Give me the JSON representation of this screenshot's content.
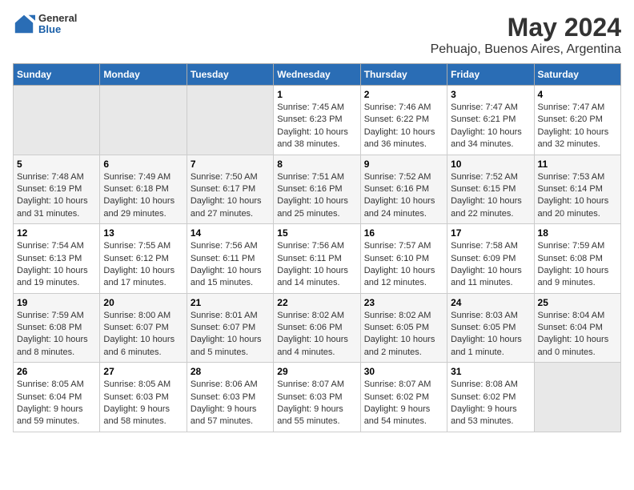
{
  "logo": {
    "general": "General",
    "blue": "Blue"
  },
  "title": "May 2024",
  "subtitle": "Pehuajo, Buenos Aires, Argentina",
  "days_of_week": [
    "Sunday",
    "Monday",
    "Tuesday",
    "Wednesday",
    "Thursday",
    "Friday",
    "Saturday"
  ],
  "weeks": [
    [
      {
        "day": "",
        "info": ""
      },
      {
        "day": "",
        "info": ""
      },
      {
        "day": "",
        "info": ""
      },
      {
        "day": "1",
        "info": "Sunrise: 7:45 AM\nSunset: 6:23 PM\nDaylight: 10 hours\nand 38 minutes."
      },
      {
        "day": "2",
        "info": "Sunrise: 7:46 AM\nSunset: 6:22 PM\nDaylight: 10 hours\nand 36 minutes."
      },
      {
        "day": "3",
        "info": "Sunrise: 7:47 AM\nSunset: 6:21 PM\nDaylight: 10 hours\nand 34 minutes."
      },
      {
        "day": "4",
        "info": "Sunrise: 7:47 AM\nSunset: 6:20 PM\nDaylight: 10 hours\nand 32 minutes."
      }
    ],
    [
      {
        "day": "5",
        "info": "Sunrise: 7:48 AM\nSunset: 6:19 PM\nDaylight: 10 hours\nand 31 minutes."
      },
      {
        "day": "6",
        "info": "Sunrise: 7:49 AM\nSunset: 6:18 PM\nDaylight: 10 hours\nand 29 minutes."
      },
      {
        "day": "7",
        "info": "Sunrise: 7:50 AM\nSunset: 6:17 PM\nDaylight: 10 hours\nand 27 minutes."
      },
      {
        "day": "8",
        "info": "Sunrise: 7:51 AM\nSunset: 6:16 PM\nDaylight: 10 hours\nand 25 minutes."
      },
      {
        "day": "9",
        "info": "Sunrise: 7:52 AM\nSunset: 6:16 PM\nDaylight: 10 hours\nand 24 minutes."
      },
      {
        "day": "10",
        "info": "Sunrise: 7:52 AM\nSunset: 6:15 PM\nDaylight: 10 hours\nand 22 minutes."
      },
      {
        "day": "11",
        "info": "Sunrise: 7:53 AM\nSunset: 6:14 PM\nDaylight: 10 hours\nand 20 minutes."
      }
    ],
    [
      {
        "day": "12",
        "info": "Sunrise: 7:54 AM\nSunset: 6:13 PM\nDaylight: 10 hours\nand 19 minutes."
      },
      {
        "day": "13",
        "info": "Sunrise: 7:55 AM\nSunset: 6:12 PM\nDaylight: 10 hours\nand 17 minutes."
      },
      {
        "day": "14",
        "info": "Sunrise: 7:56 AM\nSunset: 6:11 PM\nDaylight: 10 hours\nand 15 minutes."
      },
      {
        "day": "15",
        "info": "Sunrise: 7:56 AM\nSunset: 6:11 PM\nDaylight: 10 hours\nand 14 minutes."
      },
      {
        "day": "16",
        "info": "Sunrise: 7:57 AM\nSunset: 6:10 PM\nDaylight: 10 hours\nand 12 minutes."
      },
      {
        "day": "17",
        "info": "Sunrise: 7:58 AM\nSunset: 6:09 PM\nDaylight: 10 hours\nand 11 minutes."
      },
      {
        "day": "18",
        "info": "Sunrise: 7:59 AM\nSunset: 6:08 PM\nDaylight: 10 hours\nand 9 minutes."
      }
    ],
    [
      {
        "day": "19",
        "info": "Sunrise: 7:59 AM\nSunset: 6:08 PM\nDaylight: 10 hours\nand 8 minutes."
      },
      {
        "day": "20",
        "info": "Sunrise: 8:00 AM\nSunset: 6:07 PM\nDaylight: 10 hours\nand 6 minutes."
      },
      {
        "day": "21",
        "info": "Sunrise: 8:01 AM\nSunset: 6:07 PM\nDaylight: 10 hours\nand 5 minutes."
      },
      {
        "day": "22",
        "info": "Sunrise: 8:02 AM\nSunset: 6:06 PM\nDaylight: 10 hours\nand 4 minutes."
      },
      {
        "day": "23",
        "info": "Sunrise: 8:02 AM\nSunset: 6:05 PM\nDaylight: 10 hours\nand 2 minutes."
      },
      {
        "day": "24",
        "info": "Sunrise: 8:03 AM\nSunset: 6:05 PM\nDaylight: 10 hours\nand 1 minute."
      },
      {
        "day": "25",
        "info": "Sunrise: 8:04 AM\nSunset: 6:04 PM\nDaylight: 10 hours\nand 0 minutes."
      }
    ],
    [
      {
        "day": "26",
        "info": "Sunrise: 8:05 AM\nSunset: 6:04 PM\nDaylight: 9 hours\nand 59 minutes."
      },
      {
        "day": "27",
        "info": "Sunrise: 8:05 AM\nSunset: 6:03 PM\nDaylight: 9 hours\nand 58 minutes."
      },
      {
        "day": "28",
        "info": "Sunrise: 8:06 AM\nSunset: 6:03 PM\nDaylight: 9 hours\nand 57 minutes."
      },
      {
        "day": "29",
        "info": "Sunrise: 8:07 AM\nSunset: 6:03 PM\nDaylight: 9 hours\nand 55 minutes."
      },
      {
        "day": "30",
        "info": "Sunrise: 8:07 AM\nSunset: 6:02 PM\nDaylight: 9 hours\nand 54 minutes."
      },
      {
        "day": "31",
        "info": "Sunrise: 8:08 AM\nSunset: 6:02 PM\nDaylight: 9 hours\nand 53 minutes."
      },
      {
        "day": "",
        "info": ""
      }
    ]
  ]
}
